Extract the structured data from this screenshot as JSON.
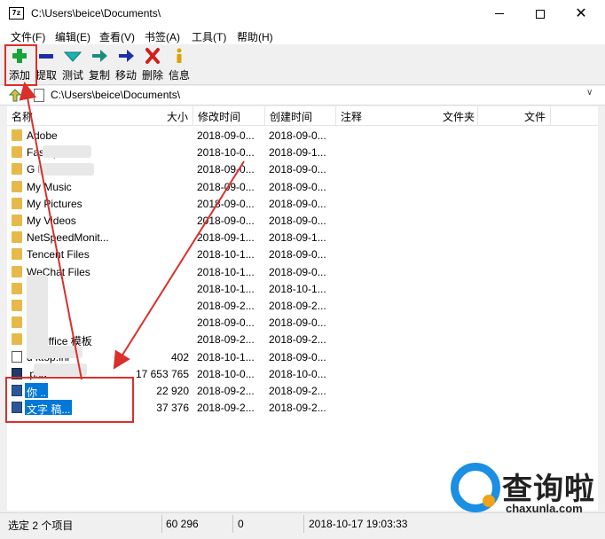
{
  "window": {
    "title": "C:\\Users\\beice\\Documents\\",
    "app_icon_text": "7z"
  },
  "menu": [
    "文件(F)",
    "编辑(E)",
    "查看(V)",
    "书签(A)",
    "工具(T)",
    "帮助(H)"
  ],
  "toolbar": [
    {
      "label": "添加",
      "icon": "add-icon",
      "color": "#1aa33a"
    },
    {
      "label": "提取",
      "icon": "extract-icon",
      "color": "#1c2fa6"
    },
    {
      "label": "测试",
      "icon": "test-icon",
      "color": "#18b3b0"
    },
    {
      "label": "复制",
      "icon": "copy-icon",
      "color": "#1a8e7a"
    },
    {
      "label": "移动",
      "icon": "move-icon",
      "color": "#1c2fa6"
    },
    {
      "label": "删除",
      "icon": "delete-icon",
      "color": "#d21e1e"
    },
    {
      "label": "信息",
      "icon": "info-icon",
      "color": "#d9a400"
    }
  ],
  "address": {
    "path": "C:\\Users\\beice\\Documents\\"
  },
  "columns": [
    "名称",
    "大小",
    "修改时间",
    "创建时间",
    "注释",
    "文件夹",
    "文件"
  ],
  "rows": [
    {
      "name": "Adobe",
      "type": "folder",
      "size": "",
      "modified": "2018-09-0...",
      "created": "2018-09-0..."
    },
    {
      "name": "Fas        aptu...",
      "type": "folder",
      "size": "",
      "modified": "2018-10-0...",
      "created": "2018-09-1..."
    },
    {
      "name": "G              Files",
      "type": "folder",
      "size": "",
      "modified": "2018-09-0...",
      "created": "2018-09-0..."
    },
    {
      "name": "My Music",
      "type": "folder",
      "size": "",
      "modified": "2018-09-0...",
      "created": "2018-09-0..."
    },
    {
      "name": "My Pictures",
      "type": "folder",
      "size": "",
      "modified": "2018-09-0...",
      "created": "2018-09-0..."
    },
    {
      "name": "My Videos",
      "type": "folder",
      "size": "",
      "modified": "2018-09-0...",
      "created": "2018-09-0..."
    },
    {
      "name": "NetSpeedMonit...",
      "type": "folder",
      "size": "",
      "modified": "2018-09-1...",
      "created": "2018-09-1..."
    },
    {
      "name": "Tencent Files",
      "type": "folder",
      "size": "",
      "modified": "2018-10-1...",
      "created": "2018-09-0..."
    },
    {
      "name": "WeChat Files",
      "type": "folder",
      "size": "",
      "modified": "2018-10-1...",
      "created": "2018-09-0..."
    },
    {
      "name": "",
      "type": "folder",
      "size": "",
      "modified": "2018-10-1...",
      "created": "2018-10-1..."
    },
    {
      "name": "",
      "type": "folder",
      "size": "",
      "modified": "2018-09-2...",
      "created": "2018-09-2..."
    },
    {
      "name": "",
      "type": "folder",
      "size": "",
      "modified": "2018-09-0...",
      "created": "2018-09-0..."
    },
    {
      "name": "     义 Office 模板",
      "type": "folder",
      "size": "",
      "modified": "2018-09-2...",
      "created": "2018-09-2..."
    },
    {
      "name": "d     ktop.ini",
      "type": "file",
      "size": "402",
      "modified": "2018-10-1...",
      "created": "2018-09-0..."
    },
    {
      "name": "           .psd",
      "type": "psd",
      "size": "17 653 765",
      "modified": "2018-10-0...",
      "created": "2018-10-0..."
    },
    {
      "name": "你              ..",
      "type": "word",
      "size": "22 920",
      "modified": "2018-09-2...",
      "created": "2018-09-2..."
    },
    {
      "name": "文字              稿...",
      "type": "word",
      "size": "37 376",
      "modified": "2018-09-2...",
      "created": "2018-09-2..."
    }
  ],
  "status": {
    "selection": "选定 2 个项目",
    "total_size": "60 296",
    "packed_size": "0",
    "datetime": "2018-10-17 19:03:33"
  },
  "watermark": {
    "cn": "查询啦",
    "en": "chaxunla.com"
  },
  "colors": {
    "selection": "#0078d7",
    "highlight_red": "#d9302b",
    "folder": "#e6b94a"
  }
}
